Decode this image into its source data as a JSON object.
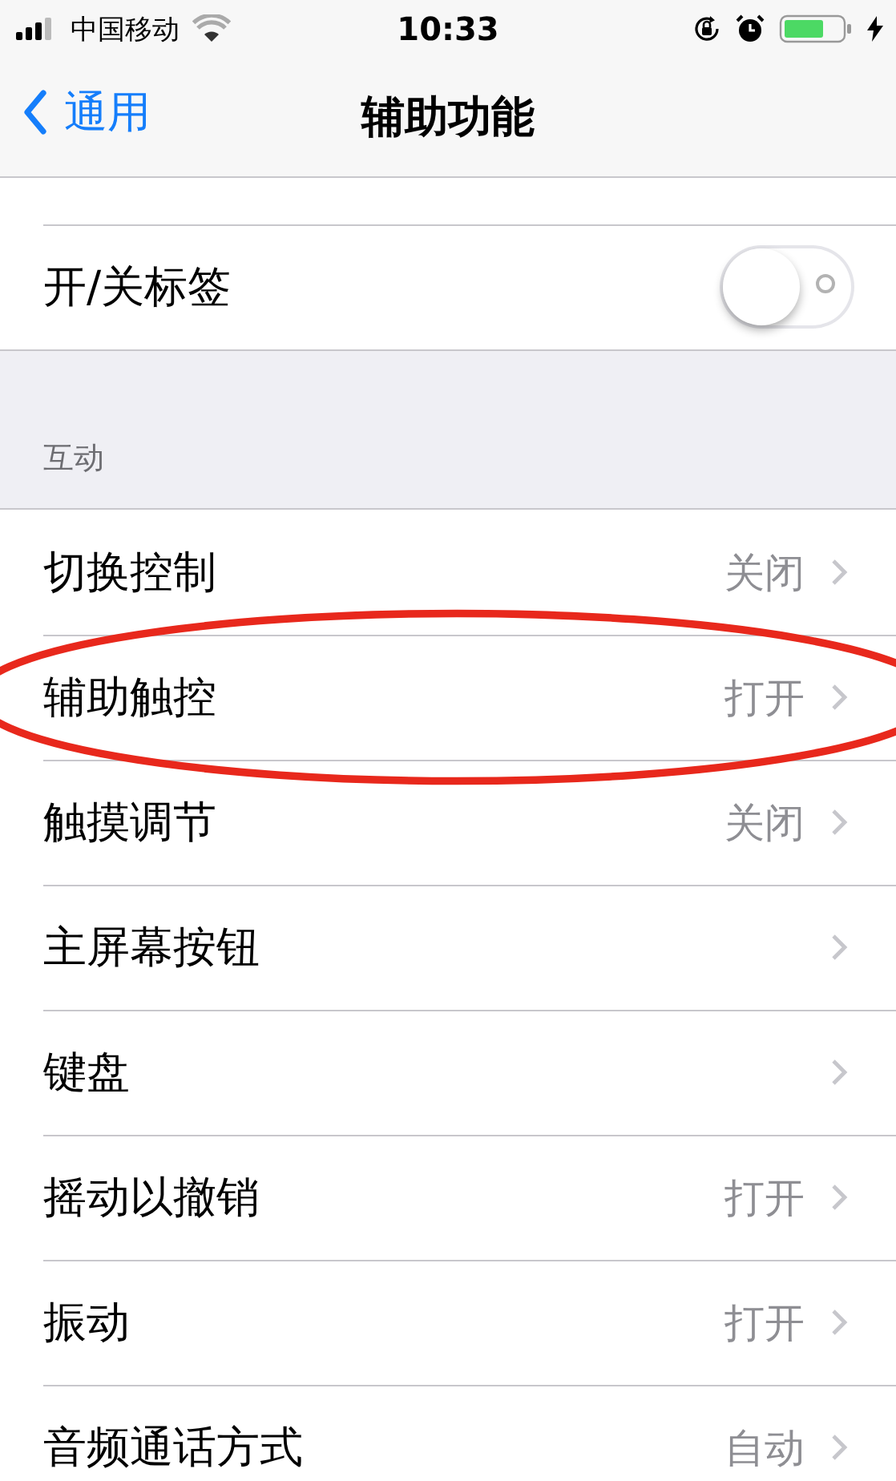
{
  "status_bar": {
    "carrier": "中国移动",
    "time": "10:33"
  },
  "nav": {
    "back": "通用",
    "title": "辅助功能"
  },
  "sections": [
    {
      "rows": [
        {
          "kind": "cut"
        },
        {
          "kind": "toggle",
          "label": "开/关标签",
          "on": false
        }
      ]
    },
    {
      "header": "互动",
      "rows": [
        {
          "kind": "link",
          "label": "切换控制",
          "value": "关闭",
          "circled": false
        },
        {
          "kind": "link",
          "label": "辅助触控",
          "value": "打开",
          "circled": true
        },
        {
          "kind": "link",
          "label": "触摸调节",
          "value": "关闭",
          "circled": false
        },
        {
          "kind": "link",
          "label": "主屏幕按钮",
          "circled": false
        },
        {
          "kind": "link",
          "label": "键盘",
          "circled": false
        },
        {
          "kind": "link",
          "label": "摇动以撤销",
          "value": "打开",
          "circled": false
        },
        {
          "kind": "link",
          "label": "振动",
          "value": "打开",
          "circled": false
        },
        {
          "kind": "link",
          "label": "音频通话方式",
          "value": "自动",
          "circled": false
        }
      ]
    }
  ]
}
